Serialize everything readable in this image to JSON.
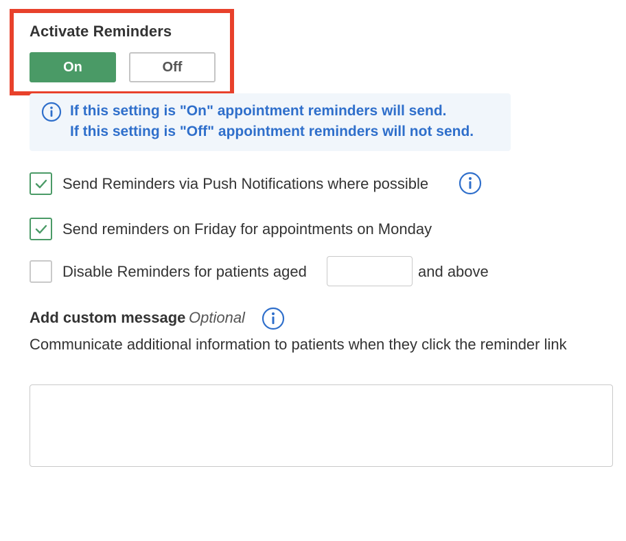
{
  "activate": {
    "title": "Activate Reminders",
    "on_label": "On",
    "off_label": "Off",
    "selected": "On"
  },
  "info": {
    "line1": "If this setting is \"On\" appointment reminders will send.",
    "line2": "If this setting is \"Off\" appointment reminders will not send."
  },
  "options": {
    "push": {
      "label": "Send Reminders via Push Notifications where possible",
      "checked": true
    },
    "friday": {
      "label": "Send reminders on Friday for appointments on Monday",
      "checked": true
    },
    "disable_age": {
      "label": "Disable Reminders for patients aged",
      "checked": false,
      "value": "",
      "suffix": "and above"
    }
  },
  "custom_message": {
    "title": "Add custom message",
    "optional": "Optional",
    "description": "Communicate additional information to patients when they click the reminder link",
    "value": ""
  },
  "colors": {
    "accent_green": "#4a9a66",
    "info_blue": "#2f6fcb",
    "highlight_red": "#e8412b",
    "info_bg": "#f1f6fb"
  },
  "icons": {
    "info": "info-circle-icon",
    "check": "checkmark-icon"
  }
}
